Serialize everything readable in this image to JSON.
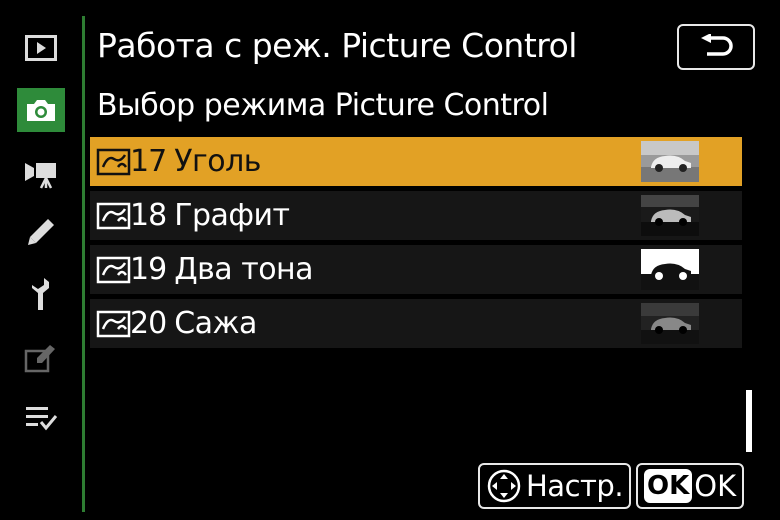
{
  "header": {
    "title": "Работа с реж. Picture Control",
    "back_icon": "return-icon"
  },
  "subtitle": "Выбор режима Picture Control",
  "sidebar": {
    "items": [
      {
        "icon": "playback-icon",
        "active": false
      },
      {
        "icon": "camera-icon",
        "active": true
      },
      {
        "icon": "movie-camera-icon",
        "active": false
      },
      {
        "icon": "pencil-icon",
        "active": false
      },
      {
        "icon": "wrench-icon",
        "active": false
      },
      {
        "icon": "retouch-icon",
        "active": false
      },
      {
        "icon": "my-menu-icon",
        "active": false
      }
    ]
  },
  "list": {
    "items": [
      {
        "number": "17",
        "name": "Уголь",
        "selected": true
      },
      {
        "number": "18",
        "name": "Графит",
        "selected": false
      },
      {
        "number": "19",
        "name": "Два тона",
        "selected": false
      },
      {
        "number": "20",
        "name": "Сажа",
        "selected": false
      }
    ]
  },
  "footer": {
    "settings_label": "Настр.",
    "ok_badge": "OK",
    "ok_label": "OK"
  },
  "colors": {
    "accent_selected": "#e2a125",
    "sidebar_active": "#2e8b3a",
    "row_bg": "#161616"
  }
}
